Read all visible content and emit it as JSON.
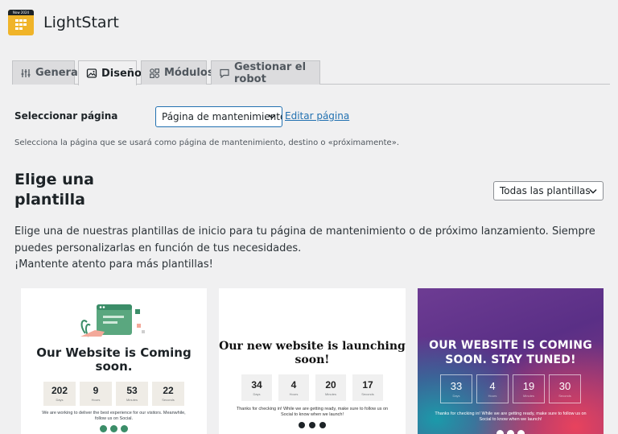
{
  "app": {
    "title": "LightStart",
    "logo_text": "Now 2024"
  },
  "tabs": [
    {
      "label": "General",
      "icon": "sliders-icon",
      "active": false
    },
    {
      "label": "Diseño",
      "icon": "image-icon",
      "active": true
    },
    {
      "label": "Módulos",
      "icon": "modules-icon",
      "active": false
    },
    {
      "label": "Gestionar el robot",
      "icon": "comment-icon",
      "active": false
    }
  ],
  "page_select": {
    "label": "Seleccionar página",
    "value": "Página de mantenimiento",
    "edit_link": "Editar página",
    "help": "Selecciona la página que se usará como página de mantenimiento, destino o «próximamente»."
  },
  "templates": {
    "heading": "Elige una plantilla",
    "filter_value": "Todas las plantillas",
    "desc_line1": "Elige una de nuestras plantillas de inicio para tu página de mantenimiento o de próximo lanzamiento. Siempre puedes personalizarlas en función de tus necesidades.",
    "desc_line2": "¡Mantente atento para más plantillas!",
    "cards": [
      {
        "title": "Our Website is Coming soon.",
        "countdown": [
          {
            "num": "202",
            "unit": "Days"
          },
          {
            "num": "9",
            "unit": "Hours"
          },
          {
            "num": "53",
            "unit": "Minutes"
          },
          {
            "num": "22",
            "unit": "Seconds"
          }
        ],
        "note": "We are working to deliver the best experience for our visitors. Meanwhile, follow us on Social."
      },
      {
        "title": "Our new website is launching soon!",
        "countdown": [
          {
            "num": "34",
            "unit": "Days"
          },
          {
            "num": "4",
            "unit": "Hours"
          },
          {
            "num": "20",
            "unit": "Minutes"
          },
          {
            "num": "17",
            "unit": "Seconds"
          }
        ],
        "note": "Thanks for checking in! While we are getting ready, make sure to follow us on Social to know when we launch!"
      },
      {
        "title": "OUR WEBSITE IS COMING SOON. STAY TUNED!",
        "countdown": [
          {
            "num": "33",
            "unit": "Days"
          },
          {
            "num": "4",
            "unit": "Hours"
          },
          {
            "num": "19",
            "unit": "Minutes"
          },
          {
            "num": "30",
            "unit": "Seconds"
          }
        ],
        "note": "Thanks for checking in! While we are getting ready, make sure to follow us on Social to know when we launch!"
      }
    ]
  },
  "colors": {
    "accent": "#2271b1",
    "logo": "#f0b429",
    "card1_green": "#3b8d68",
    "card3_purple": "#6d3c93"
  }
}
